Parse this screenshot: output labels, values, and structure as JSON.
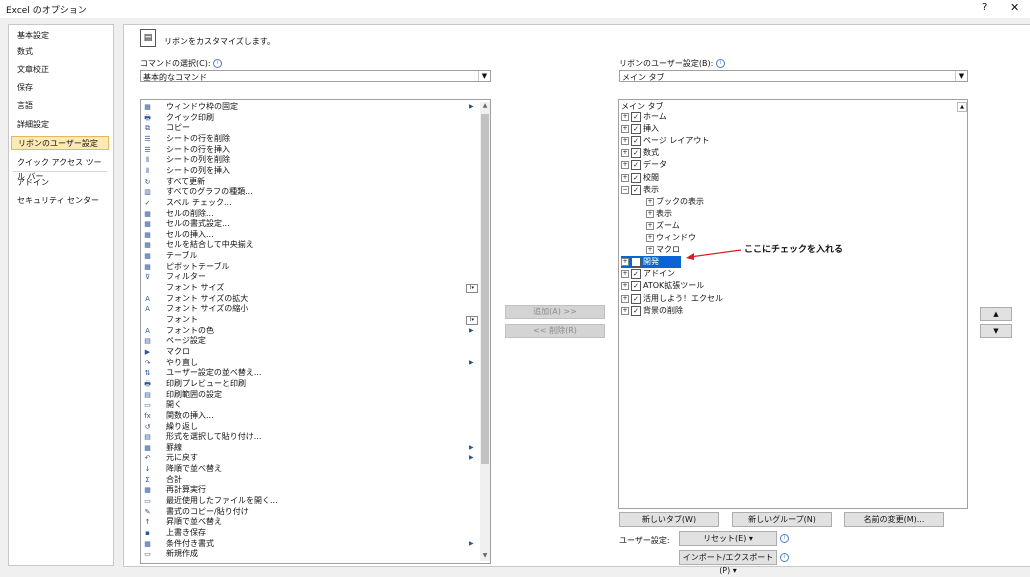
{
  "window": {
    "title": "Excel のオプション",
    "help": "?",
    "close": "✕"
  },
  "sidebar": {
    "items": [
      {
        "label": "基本設定"
      },
      {
        "label": "数式"
      },
      {
        "label": "文章校正"
      },
      {
        "label": "保存"
      },
      {
        "label": "言語"
      },
      {
        "label": "詳細設定"
      },
      {
        "label": "リボンのユーザー設定"
      },
      {
        "label": "クイック アクセス ツール バー"
      },
      {
        "label": "アドイン"
      },
      {
        "label": "セキュリティ センター"
      }
    ]
  },
  "header": {
    "title": "リボンをカスタマイズします。"
  },
  "left": {
    "label": "コマンドの選択(C):",
    "combo_value": "基本的なコマンド",
    "commands": [
      {
        "label": "ウィンドウ枠の固定",
        "icon": "▦",
        "sub": true
      },
      {
        "label": "クイック印刷",
        "icon": "🖶"
      },
      {
        "label": "コピー",
        "icon": "⧉"
      },
      {
        "label": "シートの行を削除",
        "icon": "☰"
      },
      {
        "label": "シートの行を挿入",
        "icon": "☰"
      },
      {
        "label": "シートの列を削除",
        "icon": "⫴"
      },
      {
        "label": "シートの列を挿入",
        "icon": "⫴"
      },
      {
        "label": "すべて更新",
        "icon": "↻"
      },
      {
        "label": "すべてのグラフの種類...",
        "icon": "▥"
      },
      {
        "label": "スペル チェック...",
        "icon": "✓"
      },
      {
        "label": "セルの削除...",
        "icon": "▦"
      },
      {
        "label": "セルの書式設定...",
        "icon": "▦"
      },
      {
        "label": "セルの挿入...",
        "icon": "▦"
      },
      {
        "label": "セルを結合して中央揃え",
        "icon": "▦"
      },
      {
        "label": "テーブル",
        "icon": "▦"
      },
      {
        "label": "ピボットテーブル",
        "icon": "▦"
      },
      {
        "label": "フィルター",
        "icon": "⊽"
      },
      {
        "label": "フォント サイズ",
        "icon": "",
        "ddl": true
      },
      {
        "label": "フォント サイズの拡大",
        "icon": "A"
      },
      {
        "label": "フォント サイズの縮小",
        "icon": "A"
      },
      {
        "label": "フォント",
        "icon": "",
        "ddl": true
      },
      {
        "label": "フォントの色",
        "icon": "A",
        "sub": true
      },
      {
        "label": "ページ設定",
        "icon": "▤"
      },
      {
        "label": "マクロ",
        "icon": "▶"
      },
      {
        "label": "やり直し",
        "icon": "↷",
        "sub": true
      },
      {
        "label": "ユーザー設定の並べ替え...",
        "icon": "⇅"
      },
      {
        "label": "印刷プレビューと印刷",
        "icon": "🖶"
      },
      {
        "label": "印刷範囲の設定",
        "icon": "▤"
      },
      {
        "label": "開く",
        "icon": "▭"
      },
      {
        "label": "関数の挿入...",
        "icon": "fx"
      },
      {
        "label": "繰り返し",
        "icon": "↺"
      },
      {
        "label": "形式を選択して貼り付け...",
        "icon": "▤"
      },
      {
        "label": "罫線",
        "icon": "▦",
        "sub": true
      },
      {
        "label": "元に戻す",
        "icon": "↶",
        "sub": true
      },
      {
        "label": "降順で並べ替え",
        "icon": "↓"
      },
      {
        "label": "合計",
        "icon": "Σ"
      },
      {
        "label": "再計算実行",
        "icon": "▦"
      },
      {
        "label": "最近使用したファイルを開く...",
        "icon": "▭"
      },
      {
        "label": "書式のコピー/貼り付け",
        "icon": "✎"
      },
      {
        "label": "昇順で並べ替え",
        "icon": "↑"
      },
      {
        "label": "上書き保存",
        "icon": "▪"
      },
      {
        "label": "条件付き書式",
        "icon": "▦",
        "sub": true
      },
      {
        "label": "新規作成",
        "icon": "▭"
      }
    ]
  },
  "middle": {
    "add_label": "追加(A) >>",
    "remove_label": "<< 削除(R)"
  },
  "right": {
    "label": "リボンのユーザー設定(B):",
    "combo_value": "メイン タブ",
    "tree_header": "メイン タブ",
    "tree": [
      {
        "label": "ホーム",
        "checked": true,
        "level": 0,
        "exp": "+"
      },
      {
        "label": "挿入",
        "checked": true,
        "level": 0,
        "exp": "+"
      },
      {
        "label": "ページ レイアウト",
        "checked": true,
        "level": 0,
        "exp": "+"
      },
      {
        "label": "数式",
        "checked": true,
        "level": 0,
        "exp": "+"
      },
      {
        "label": "データ",
        "checked": true,
        "level": 0,
        "exp": "+"
      },
      {
        "label": "校閲",
        "checked": true,
        "level": 0,
        "exp": "+"
      },
      {
        "label": "表示",
        "checked": true,
        "level": 0,
        "exp": "−"
      },
      {
        "label": "ブックの表示",
        "checked": null,
        "level": 1,
        "exp": "+"
      },
      {
        "label": "表示",
        "checked": null,
        "level": 1,
        "exp": "+"
      },
      {
        "label": "ズーム",
        "checked": null,
        "level": 1,
        "exp": "+"
      },
      {
        "label": "ウィンドウ",
        "checked": null,
        "level": 1,
        "exp": "+"
      },
      {
        "label": "マクロ",
        "checked": null,
        "level": 1,
        "exp": "+"
      },
      {
        "label": "開発",
        "checked": false,
        "level": 0,
        "exp": "+",
        "selected": true
      },
      {
        "label": "アドイン",
        "checked": true,
        "level": 0,
        "exp": "+"
      },
      {
        "label": "ATOK拡張ツール",
        "checked": true,
        "level": 0,
        "exp": "+"
      },
      {
        "label": "活用しよう！エクセル",
        "checked": true,
        "level": 0,
        "exp": "+"
      },
      {
        "label": "背景の削除",
        "checked": true,
        "level": 0,
        "exp": "+"
      }
    ],
    "annotation": "ここにチェックを入れる",
    "new_tab": "新しいタブ(W)",
    "new_group": "新しいグループ(N)",
    "rename": "名前の変更(M)...",
    "user_settings_label": "ユーザー設定:",
    "reset": "リセット(E) ▾",
    "import_export": "インポート/エクスポート(P) ▾",
    "up": "▲",
    "down": "▼"
  },
  "colors": {
    "selected_sidebar": "#fde9b4",
    "selected_tree": "#0a64d2",
    "annotation_arrow": "#d81e1e"
  }
}
